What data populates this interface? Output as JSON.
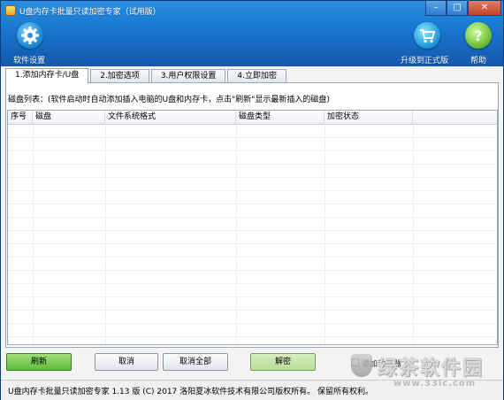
{
  "window": {
    "title": "U盘内存卡批量只读加密专家（试用版）",
    "controls": {
      "minimize": "–",
      "maximize": "□",
      "close": "✕"
    }
  },
  "toolbar": {
    "settings_label": "软件设置",
    "upgrade_label": "升级到正式版",
    "help_label": "帮助"
  },
  "tabs": [
    {
      "label": "1.添加内存卡/U盘",
      "active": true
    },
    {
      "label": "2.加密选项",
      "active": false
    },
    {
      "label": "3.用户权限设置",
      "active": false
    },
    {
      "label": "4.立即加密",
      "active": false
    }
  ],
  "disk_list": {
    "caption": "磁盘列表：(软件启动时自动添加插入电脑的U盘和内存卡，点击\"刷新\"显示最新插入的磁盘)",
    "columns": [
      "序号",
      "磁盘",
      "文件系统格式",
      "磁盘类型",
      "加密状态"
    ],
    "rows": []
  },
  "buttons": {
    "refresh": "刷新",
    "cancel": "取消",
    "cancel_all": "取消全部",
    "decrypt": "解密"
  },
  "options": {
    "auto_add_label": "添加动动器",
    "auto_add_checked": false
  },
  "status_bar": {
    "text": "U盘内存卡批量只读加密专家 1.13 版 (C) 2017 洛阳夏冰软件技术有限公司版权所有。 保留所有权利。"
  },
  "watermark": {
    "text": "绿茶软件园",
    "url": "www.33lc.com"
  },
  "colors": {
    "header_blue": "#1a7bd3",
    "refresh_green": "#5dbb3a",
    "decrypt_green": "#b8dc97"
  }
}
